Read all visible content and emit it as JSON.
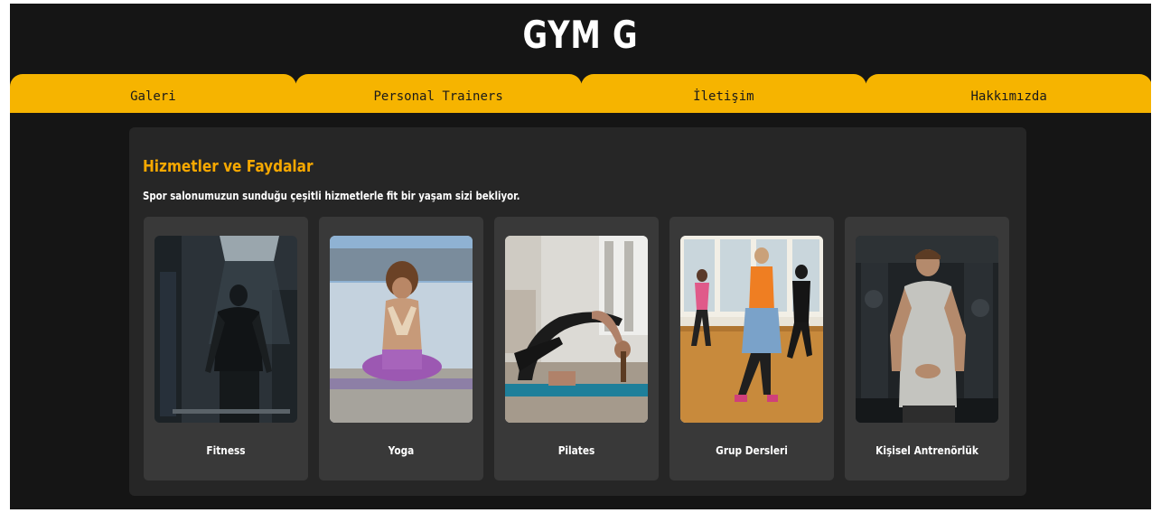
{
  "site": {
    "title": "GYM G"
  },
  "nav": {
    "items": [
      {
        "label": "Galeri"
      },
      {
        "label": "Personal Trainers"
      },
      {
        "label": "İletişim"
      },
      {
        "label": "Hakkımızda"
      }
    ]
  },
  "services": {
    "heading": "Hizmetler ve Faydalar",
    "subtitle": "Spor salonumuzun sunduğu çeşitli hizmetlerle fit bir yaşam sizi bekliyor.",
    "cards": [
      {
        "label": "Fitness"
      },
      {
        "label": "Yoga"
      },
      {
        "label": "Pilates"
      },
      {
        "label": "Grup Dersleri"
      },
      {
        "label": "Kişisel Antrenörlük"
      }
    ]
  },
  "colors": {
    "accent": "#f6b400",
    "background": "#151515",
    "panel": "#262626",
    "card": "#393939",
    "heading": "#f6a800"
  }
}
